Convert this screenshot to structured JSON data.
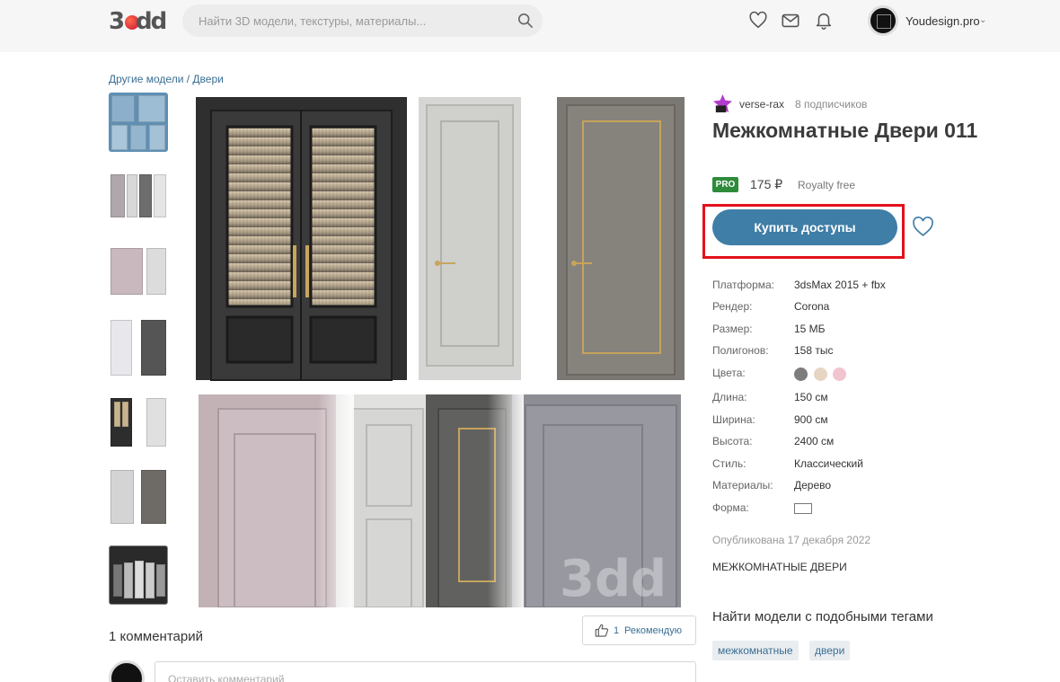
{
  "header": {
    "logo_text": "3dd",
    "search_placeholder": "Найти 3D модели, текстуры, материалы...",
    "user_name": "Youdesign.pro",
    "icons": [
      "search-icon",
      "heart-icon",
      "mail-icon",
      "bell-icon",
      "chevron-down-icon"
    ]
  },
  "breadcrumb": {
    "parent": "Другие модели",
    "separator": " / ",
    "current": "Двери"
  },
  "thumbnails": [
    "thumb-1",
    "thumb-2",
    "thumb-3",
    "thumb-4",
    "thumb-5",
    "thumb-6",
    "thumb-7"
  ],
  "watermark": "3dd",
  "author": {
    "name": "verse-rax",
    "subscribers": "8 подписчиков"
  },
  "product": {
    "title": "Межкомнатные Двери 011",
    "pro_badge": "PRO",
    "price": "175 ₽",
    "license": "Royalty free",
    "buy_label": "Купить доступы"
  },
  "specs": [
    {
      "key": "Платформа:",
      "value": "3dsMax 2015 + fbx"
    },
    {
      "key": "Рендер:",
      "value": "Corona"
    },
    {
      "key": "Размер:",
      "value": "15 МБ"
    },
    {
      "key": "Полигонов:",
      "value": "158 тыс"
    },
    {
      "key": "Цвета:",
      "value": ""
    },
    {
      "key": "Длина:",
      "value": "150 см"
    },
    {
      "key": "Ширина:",
      "value": "900 см"
    },
    {
      "key": "Высота:",
      "value": "2400 см"
    },
    {
      "key": "Стиль:",
      "value": "Классический"
    },
    {
      "key": "Материалы:",
      "value": "Дерево"
    },
    {
      "key": "Форма:",
      "value": ""
    }
  ],
  "colors": [
    "#7d7d7d",
    "#e6d5c3",
    "#f2c4cf"
  ],
  "published": "Опубликована 17 декабря 2022",
  "category": "МЕЖКОМНАТНЫЕ ДВЕРИ",
  "similar": {
    "title": "Найти модели с подобными тегами",
    "tags": [
      "межкомнатные",
      "двери"
    ]
  },
  "comments": {
    "count_label": "1 комментарий",
    "recommend_count": "1",
    "recommend_label": "Рекомендую",
    "input_placeholder": "Оставить комментарий"
  }
}
